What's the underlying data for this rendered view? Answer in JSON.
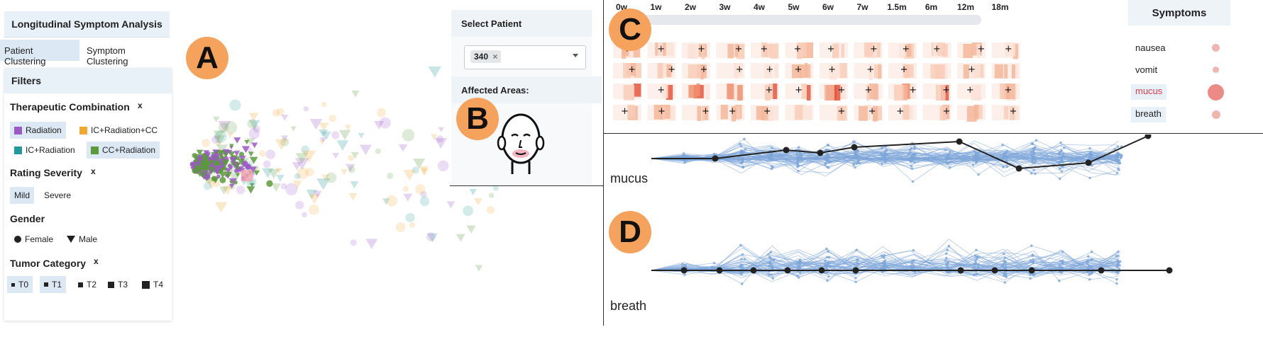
{
  "app": {
    "title": "Longitudinal Symptom Analysis",
    "tabs": [
      "Patient Clustering",
      "Symptom Clustering"
    ]
  },
  "filters": {
    "header": "Filters",
    "therapeutic": {
      "label": "Therapeutic Combination",
      "clear": "x",
      "items": [
        {
          "label": "Radiation",
          "color": "#9b59c6",
          "selected": true
        },
        {
          "label": "IC+Radiation+CC",
          "color": "#f0a830",
          "selected": false
        },
        {
          "label": "IC+Radiation",
          "color": "#22999a",
          "selected": false
        },
        {
          "label": "CC+Radiation",
          "color": "#5a9a3a",
          "selected": true
        }
      ]
    },
    "severity": {
      "label": "Rating Severity",
      "clear": "x",
      "items": [
        "Mild",
        "Severe"
      ]
    },
    "gender": {
      "label": "Gender",
      "items": [
        "Female",
        "Male"
      ]
    },
    "tumor": {
      "label": "Tumor Category",
      "clear": "x",
      "items": [
        "T0",
        "T1",
        "T2",
        "T3",
        "T4"
      ]
    }
  },
  "badges": {
    "a": "A",
    "b": "B",
    "c": "C",
    "d": "D"
  },
  "patient": {
    "select_header": "Select Patient",
    "selected_id": "340",
    "remove": "×",
    "areas_header": "Affected Areas:"
  },
  "timeline": {
    "ticks": [
      "0w",
      "1w",
      "2w",
      "3w",
      "4w",
      "5w",
      "6w",
      "7w",
      "1.5m",
      "6m",
      "12m",
      "18m"
    ],
    "slider_value": "0w"
  },
  "symptoms": {
    "header": "Symptoms",
    "items": [
      {
        "label": "nausea",
        "selected": false,
        "color": "#333333"
      },
      {
        "label": "vomit",
        "selected": false,
        "color": "#333333"
      },
      {
        "label": "mucus",
        "selected": true,
        "color": "#e0404a"
      },
      {
        "label": "breath",
        "selected": true,
        "color": "#333333"
      }
    ]
  },
  "trajectories": {
    "top_label": "mucus",
    "bottom_label": "breath",
    "line_color": "#7ea6d8",
    "highlight_color": "#222222"
  },
  "colors": {
    "radiation": "#9b59c6",
    "ic_rad_cc": "#f0a830",
    "ic_rad": "#22999a",
    "cc_rad": "#5a9a3a",
    "heat_light": "#fbe3d8",
    "heat_mid": "#f5b79a",
    "heat_dark": "#e4573d"
  }
}
